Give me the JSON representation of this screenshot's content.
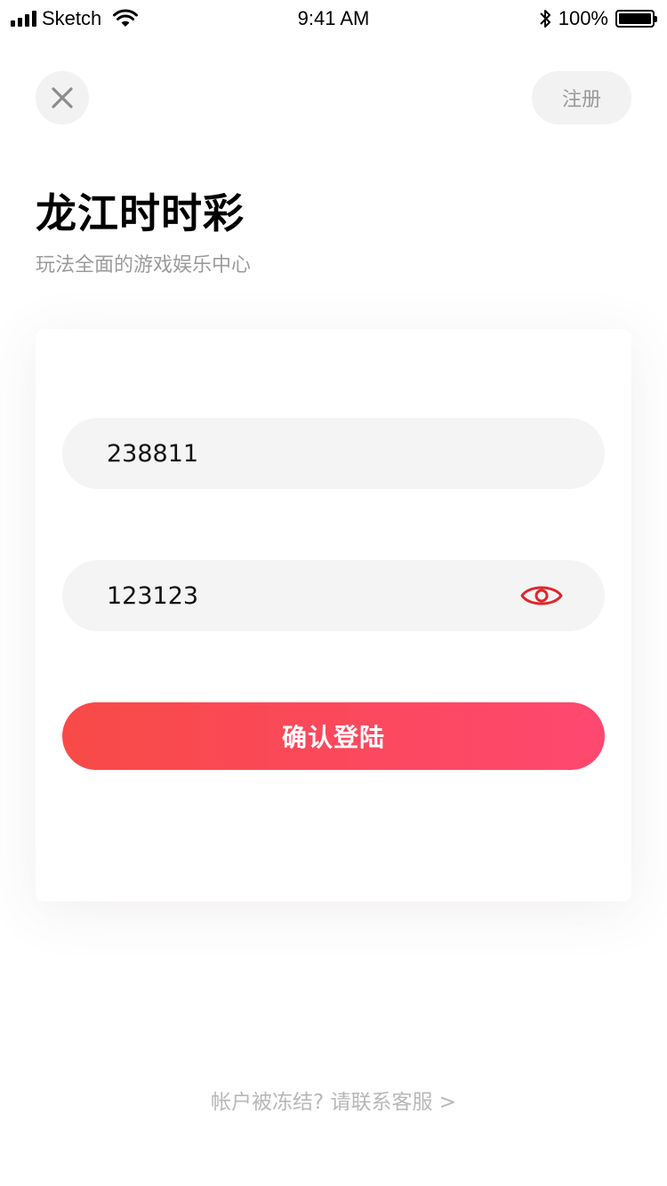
{
  "status_bar": {
    "carrier": "Sketch",
    "time": "9:41 AM",
    "battery_percent": "100%",
    "battery_level": 1.0
  },
  "header": {
    "close_icon": "close-icon",
    "register_label": "注册"
  },
  "title": "龙江时时彩",
  "subtitle": "玩法全面的游戏娱乐中心",
  "form": {
    "account_value": "238811",
    "password_value": "123123",
    "password_toggle_icon": "eye-icon",
    "submit_label": "确认登陆"
  },
  "footer": {
    "help_link": "帐户被冻结? 请联系客服 >"
  },
  "colors": {
    "accent_start": "#f84a47",
    "accent_end": "#fe4870",
    "eye_icon": "#e0262b"
  }
}
